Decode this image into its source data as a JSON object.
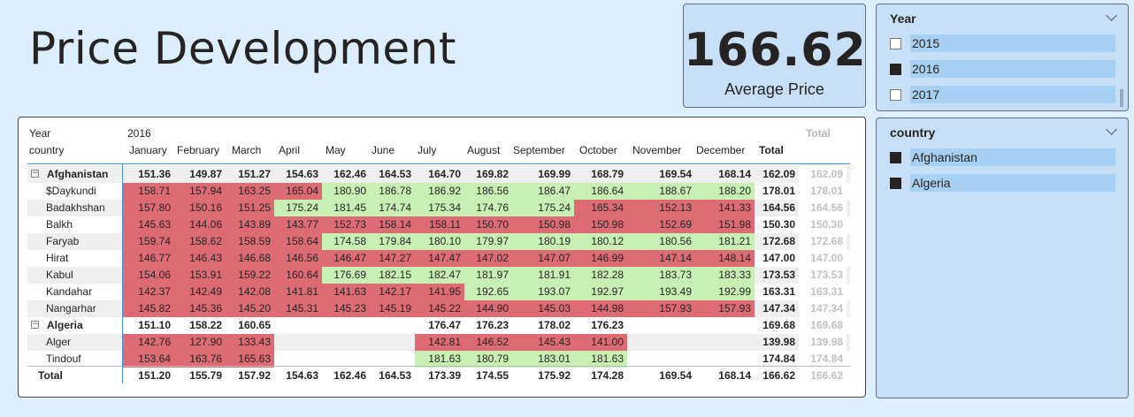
{
  "title": "Price Development",
  "card": {
    "value": "166.62",
    "label": "Average Price"
  },
  "year_slicer": {
    "title": "Year",
    "options": [
      {
        "label": "2015",
        "checked": false
      },
      {
        "label": "2016",
        "checked": true
      },
      {
        "label": "2017",
        "checked": false
      }
    ]
  },
  "country_slicer": {
    "title": "country",
    "options": [
      {
        "label": "Afghanistan",
        "checked": true
      },
      {
        "label": "Algeria",
        "checked": true
      }
    ]
  },
  "matrix": {
    "header": {
      "year_label": "Year",
      "country_label": "country",
      "year_value": "2016",
      "months": [
        "January",
        "February",
        "March",
        "April",
        "May",
        "June",
        "July",
        "August",
        "September",
        "October",
        "November",
        "December"
      ],
      "total_label": "Total",
      "grand_total_label": "Total"
    },
    "rows": [
      {
        "label": "Afghanistan",
        "level": 0,
        "expander": "⊟",
        "values": [
          "151.36",
          "149.87",
          "151.27",
          "154.63",
          "162.46",
          "164.53",
          "164.70",
          "169.82",
          "169.99",
          "168.79",
          "169.54",
          "168.14"
        ],
        "colors": [
          "",
          "",
          "",
          "",
          "",
          "",
          "",
          "",
          "",
          "",
          "",
          ""
        ],
        "total": "162.09",
        "grand": "162.09"
      },
      {
        "label": "$Daykundi",
        "level": 1,
        "values": [
          "158.71",
          "157.94",
          "163.25",
          "165.04",
          "180.90",
          "186.78",
          "186.92",
          "186.56",
          "186.47",
          "186.64",
          "188.67",
          "188.20"
        ],
        "colors": [
          "r",
          "r",
          "r",
          "r",
          "g",
          "g",
          "g",
          "g",
          "g",
          "g",
          "g",
          "g"
        ],
        "total": "178.01",
        "grand": "178.01"
      },
      {
        "label": "Badakhshan",
        "level": 1,
        "values": [
          "157.80",
          "150.16",
          "151.25",
          "175.24",
          "181.45",
          "174.74",
          "175.34",
          "174.76",
          "175.24",
          "165.34",
          "152.13",
          "141.33"
        ],
        "colors": [
          "r",
          "r",
          "r",
          "g",
          "g",
          "g",
          "g",
          "g",
          "g",
          "r",
          "r",
          "r"
        ],
        "total": "164.56",
        "grand": "164.56"
      },
      {
        "label": "Balkh",
        "level": 1,
        "values": [
          "145.63",
          "144.06",
          "143.89",
          "143.77",
          "152.73",
          "158.14",
          "158.11",
          "150.70",
          "150.98",
          "150.98",
          "152.69",
          "151.98"
        ],
        "colors": [
          "r",
          "r",
          "r",
          "r",
          "r",
          "r",
          "r",
          "r",
          "r",
          "r",
          "r",
          "r"
        ],
        "total": "150.30",
        "grand": "150.30"
      },
      {
        "label": "Faryab",
        "level": 1,
        "values": [
          "159.74",
          "158.62",
          "158.59",
          "158.64",
          "174.58",
          "179.84",
          "180.10",
          "179.97",
          "180.19",
          "180.12",
          "180.56",
          "181.21"
        ],
        "colors": [
          "r",
          "r",
          "r",
          "r",
          "g",
          "g",
          "g",
          "g",
          "g",
          "g",
          "g",
          "g"
        ],
        "total": "172.68",
        "grand": "172.68"
      },
      {
        "label": "Hirat",
        "level": 1,
        "values": [
          "146.77",
          "146.43",
          "146.68",
          "146.56",
          "146.47",
          "147.27",
          "147.47",
          "147.02",
          "147.07",
          "146.99",
          "147.14",
          "148.14"
        ],
        "colors": [
          "r",
          "r",
          "r",
          "r",
          "r",
          "r",
          "r",
          "r",
          "r",
          "r",
          "r",
          "r"
        ],
        "total": "147.00",
        "grand": "147.00"
      },
      {
        "label": "Kabul",
        "level": 1,
        "values": [
          "154.06",
          "153.91",
          "159.22",
          "160.64",
          "176.69",
          "182.15",
          "182.47",
          "181.97",
          "181.91",
          "182.28",
          "183.73",
          "183.33"
        ],
        "colors": [
          "r",
          "r",
          "r",
          "r",
          "g",
          "g",
          "g",
          "g",
          "g",
          "g",
          "g",
          "g"
        ],
        "total": "173.53",
        "grand": "173.53"
      },
      {
        "label": "Kandahar",
        "level": 1,
        "values": [
          "142.37",
          "142.49",
          "142.08",
          "141.81",
          "141.63",
          "142.17",
          "141.95",
          "192.65",
          "193.07",
          "192.97",
          "193.49",
          "192.99"
        ],
        "colors": [
          "r",
          "r",
          "r",
          "r",
          "r",
          "r",
          "r",
          "g",
          "g",
          "g",
          "g",
          "g"
        ],
        "total": "163.31",
        "grand": "163.31"
      },
      {
        "label": "Nangarhar",
        "level": 1,
        "values": [
          "145.82",
          "145.36",
          "145.20",
          "145.31",
          "145.23",
          "145.19",
          "145.22",
          "144.90",
          "145.03",
          "144.98",
          "157.93",
          "157.93"
        ],
        "colors": [
          "r",
          "r",
          "r",
          "r",
          "r",
          "r",
          "r",
          "r",
          "r",
          "r",
          "r",
          "r"
        ],
        "total": "147.34",
        "grand": "147.34"
      },
      {
        "label": "Algeria",
        "level": 0,
        "expander": "⊟",
        "values": [
          "151.10",
          "158.22",
          "160.65",
          "",
          "",
          "",
          "176.47",
          "176.23",
          "178.02",
          "176.23",
          "",
          ""
        ],
        "colors": [
          "",
          "",
          "",
          "",
          "",
          "",
          "",
          "",
          "",
          "",
          "",
          ""
        ],
        "total": "169.68",
        "grand": "169.68"
      },
      {
        "label": "Alger",
        "level": 1,
        "values": [
          "142.76",
          "127.90",
          "133.43",
          "",
          "",
          "",
          "142.81",
          "146.52",
          "145.43",
          "141.00",
          "",
          ""
        ],
        "colors": [
          "r",
          "r",
          "r",
          "",
          "",
          "",
          "r",
          "r",
          "r",
          "r",
          "",
          ""
        ],
        "total": "139.98",
        "grand": "139.98"
      },
      {
        "label": "Tindouf",
        "level": 1,
        "values": [
          "153.64",
          "163.76",
          "165.63",
          "",
          "",
          "",
          "181.63",
          "180.79",
          "183.01",
          "181.63",
          "",
          ""
        ],
        "colors": [
          "r",
          "r",
          "r",
          "",
          "",
          "",
          "g",
          "g",
          "g",
          "g",
          "",
          ""
        ],
        "total": "174.84",
        "grand": "174.84"
      },
      {
        "label": "Total",
        "level": 0,
        "values": [
          "151.20",
          "155.79",
          "157.92",
          "154.63",
          "162.46",
          "164.53",
          "173.39",
          "174.55",
          "175.92",
          "174.28",
          "169.54",
          "168.14"
        ],
        "colors": [
          "",
          "",
          "",
          "",
          "",
          "",
          "",
          "",
          "",
          "",
          "",
          ""
        ],
        "total": "166.62",
        "grand": "166.62"
      }
    ]
  }
}
